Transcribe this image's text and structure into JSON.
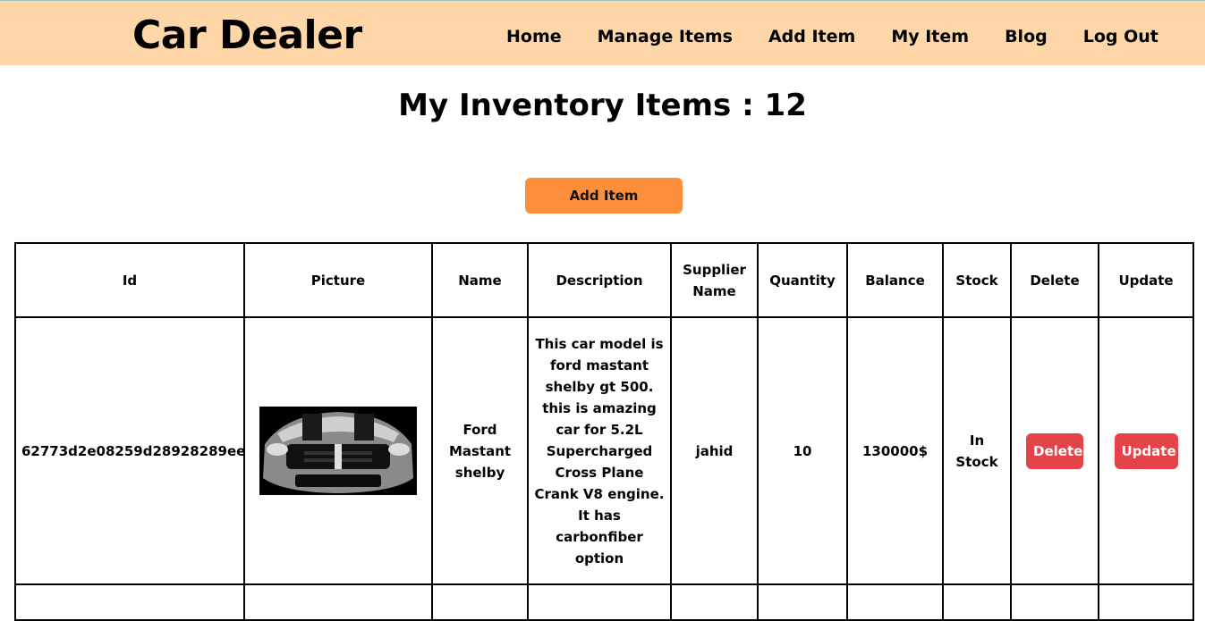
{
  "header": {
    "brand": "Car Dealer",
    "nav": [
      "Home",
      "Manage Items",
      "Add Item",
      "My Item",
      "Blog",
      "Log Out"
    ]
  },
  "main": {
    "title": "My Inventory Items : 12",
    "add_button": "Add Item"
  },
  "table": {
    "columns": [
      "Id",
      "Picture",
      "Name",
      "Description",
      "Supplier Name",
      "Quantity",
      "Balance",
      "Stock",
      "Delete",
      "Update"
    ],
    "rows": [
      {
        "id": "62773d2e08259d28928289ee",
        "picture": "car-image",
        "name": "Ford Mastant shelby",
        "description": "This car model is ford mastant shelby gt 500. this is amazing car for 5.2L Supercharged Cross Plane Crank V8 engine. It has carbonfiber option",
        "supplier": "jahid",
        "quantity": "10",
        "balance": "130000$",
        "stock": "In Stock",
        "delete_label": "Delete",
        "update_label": "Update"
      }
    ]
  },
  "colors": {
    "navbar": "#fed6a7",
    "add_button": "#fd8f3a",
    "action_button": "#e5434a"
  }
}
